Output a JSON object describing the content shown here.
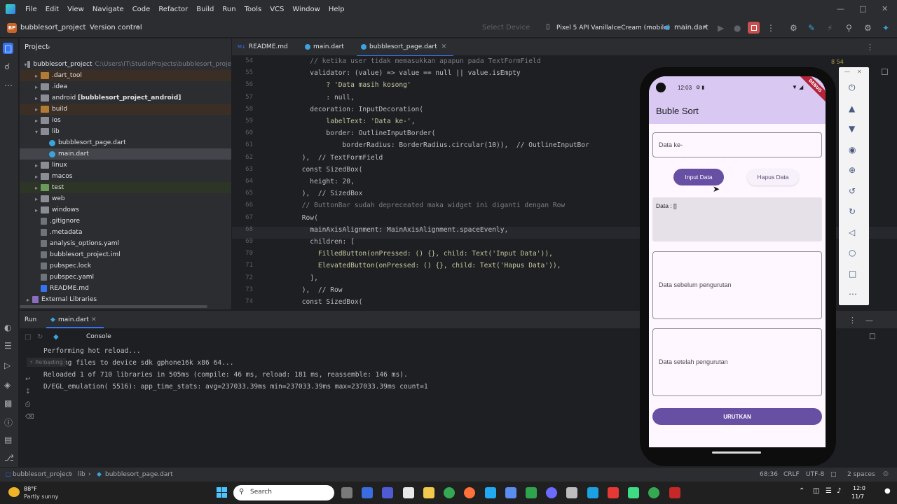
{
  "menu": [
    "File",
    "Edit",
    "View",
    "Navigate",
    "Code",
    "Refactor",
    "Build",
    "Run",
    "Tools",
    "VCS",
    "Window",
    "Help"
  ],
  "toolbar": {
    "project_badge": "BP",
    "project_name": "bubblesort_project",
    "vcs": "Version control",
    "select_device": "Select Device",
    "device": "Pixel 5 API VanillaIceCream (mobile)",
    "run_config": "main.dart"
  },
  "project_panel": {
    "title": "Project",
    "root": "bubblesort_project",
    "root_path": "C:\\Users\\IT\\StudioProjects\\bubblesort_proje",
    "items": [
      ".dart_tool",
      ".idea",
      "android",
      "build",
      "ios",
      "lib",
      "bubblesort_page.dart",
      "main.dart",
      "linux",
      "macos",
      "test",
      "web",
      "windows",
      ".gitignore",
      ".metadata",
      "analysis_options.yaml",
      "bubblesort_project.iml",
      "pubspec.lock",
      "pubspec.yaml",
      "README.md",
      "External Libraries"
    ],
    "android_module": "[bubblesort_project_android]"
  },
  "tabs": [
    "README.md",
    "main.dart",
    "bubblesort_page.dart"
  ],
  "editor": {
    "line_numbers": [
      "54",
      "55",
      "56",
      "57",
      "58",
      "59",
      "60",
      "61",
      "62",
      "63",
      "64",
      "65",
      "66",
      "67",
      "68",
      "69",
      "70",
      "71",
      "72",
      "73",
      "74"
    ],
    "lines": [
      "            // ketika user tidak memasukkan apapun pada TextFormField",
      "            validator: (value) => value == null || value.isEmpty",
      "                ? 'Data masih kosong'",
      "                : null,",
      "            decoration: InputDecoration(",
      "                labelText: 'Data ke-',",
      "                border: OutlineInputBorder(",
      "                    borderRadius: BorderRadius.circular(10)),  // OutlineInputBor",
      "          ),  // TextFormField",
      "          const SizedBox(",
      "            height: 20,",
      "          ),  // SizedBox",
      "          // ButtonBar sudah depreceated maka widget ini diganti dengan Row",
      "          Row(",
      "            mainAxisAlignment: MainAxisAlignment.spaceEvenly,",
      "            children: [",
      "              FilledButton(onPressed: () {}, child: Text('Input Data')),",
      "              ElevatedButton(onPressed: () {}, child: Text('Hapus Data')),",
      "            ],",
      "          ),  // Row",
      "          const SizedBox("
    ],
    "inspection": "8  54"
  },
  "run": {
    "tab_run": "Run",
    "tab_file": "main.dart",
    "console_label": "Console",
    "lines": [
      "Performing hot reload...",
      "Syncing files to device sdk gphone16k x86 64...",
      "Reloaded 1 of 710 libraries in 505ms (compile: 46 ms, reload: 181 ms, reassemble: 146 ms).",
      "D/EGL_emulation( 5516): app_time_stats: avg=237033.39ms min=237033.39ms max=237033.39ms count=1"
    ],
    "overlay_text": "Reloading"
  },
  "status": {
    "breadcrumb": [
      "bubblesort_project",
      "lib",
      "bubblesort_page.dart"
    ],
    "position": "68:36",
    "line_ending": "CRLF",
    "encoding": "UTF-8",
    "indent": "2 spaces"
  },
  "taskbar": {
    "weather_temp": "88°F",
    "weather_desc": "Partly sunny",
    "search": "Search",
    "time": "12:0",
    "date": "11/7"
  },
  "phone": {
    "status_time": "12:03",
    "debug": "DEBUG",
    "app_title": "Buble Sort",
    "field_label": "Data ke-",
    "btn_input": "Input Data",
    "btn_hapus": "Hapus Data",
    "data_text": "Data : []",
    "before_text": "Data sebelum pengurutan",
    "after_text": "Data setelah pengurutan",
    "sort_button": "URUTKAN"
  },
  "colors": {
    "accent": "#3574f0",
    "phone_primary": "#6750a4",
    "appbar": "#d8c8f2"
  }
}
